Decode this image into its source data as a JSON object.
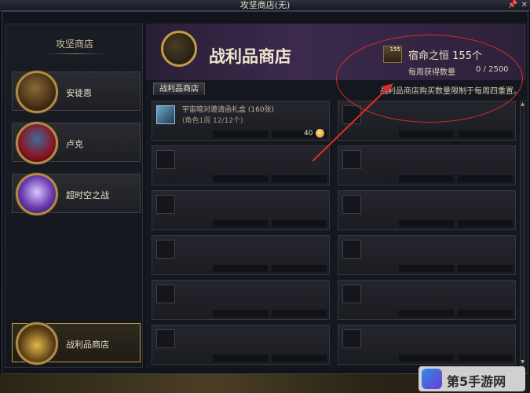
{
  "window": {
    "title": "攻坚商店(无)"
  },
  "sidebar": {
    "title": "攻坚商店",
    "heroes": [
      {
        "label": "安徒恩"
      },
      {
        "label": "卢克"
      },
      {
        "label": "超时空之战"
      }
    ],
    "active": {
      "label": "战利品商店"
    }
  },
  "shop": {
    "title": "战利品商店",
    "currency": {
      "name": "宿命之恒",
      "count_text": "155个",
      "icon_count": "155"
    },
    "weekly": {
      "label": "每周获得数量",
      "value": "0 / 2500"
    },
    "tab_label": "战利品商店",
    "limit_note": "战利品商店购买数量限制于每周四重置。",
    "items": [
      {
        "name": "宇宙暗对邀请函礼盒 (160张)",
        "sub": "(角色1周 12/12个)",
        "price": "40"
      }
    ]
  },
  "watermark": {
    "text": "第5手游网"
  }
}
